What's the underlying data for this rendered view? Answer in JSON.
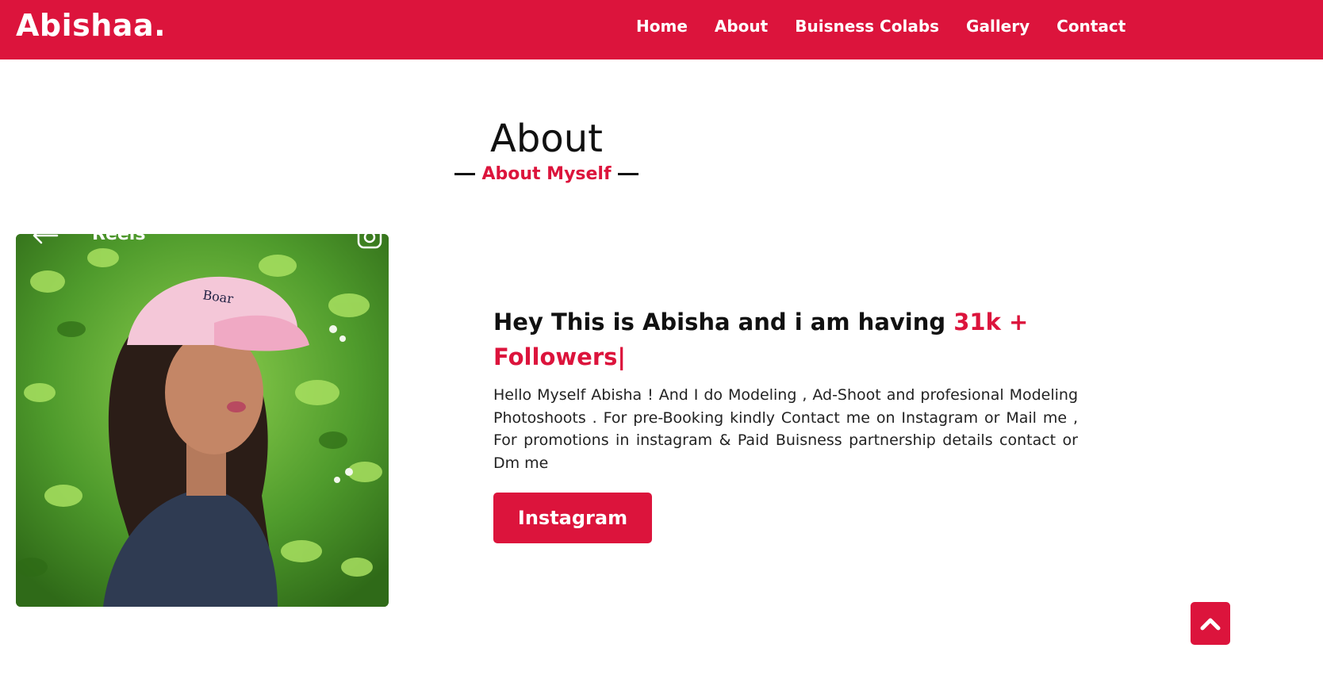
{
  "brand": {
    "logo_text": "Abishaa."
  },
  "nav": {
    "items": [
      {
        "label": "Home"
      },
      {
        "label": "About"
      },
      {
        "label": "Buisness Colabs"
      },
      {
        "label": "Gallery"
      },
      {
        "label": "Contact"
      }
    ]
  },
  "section": {
    "title": "About",
    "subtitle": "About Myself"
  },
  "photo": {
    "overlay_label": "Reels",
    "icons": [
      "back-arrow-icon",
      "instagram-icon"
    ]
  },
  "about": {
    "heading_prefix": "Hey This is Abisha and i am having ",
    "heading_accent": "31k + Followers|",
    "body": "Hello Myself Abisha ! And I do Modeling , Ad-Shoot and profesional Modeling Photoshoots . For pre-Booking kindly Contact me on Instagram or Mail me , For promotions in instagram & Paid Buisness partnership details contact or Dm me",
    "button_label": "Instagram"
  },
  "scroll_top": {
    "icon": "chevron-up-icon"
  },
  "colors": {
    "brand_red": "#dc143c",
    "text_dark": "#111111",
    "background": "#ffffff"
  }
}
